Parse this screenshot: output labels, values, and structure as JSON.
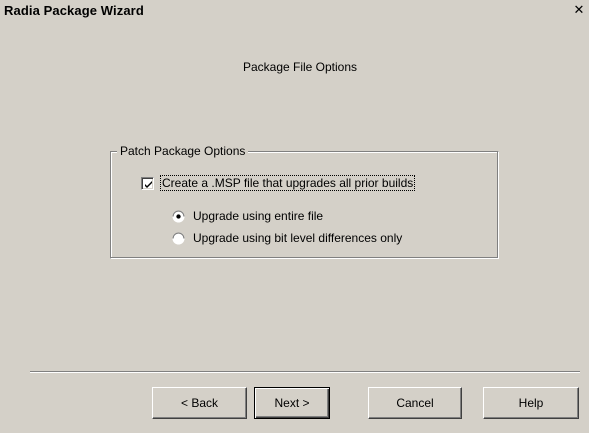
{
  "window": {
    "title": "Radia Package Wizard",
    "close_symbol": "✕"
  },
  "page": {
    "heading": "Package File Options"
  },
  "group": {
    "legend": "Patch Package Options",
    "checkbox": {
      "label": "Create a .MSP file that upgrades all prior builds",
      "checked": true
    },
    "radios": [
      {
        "label": "Upgrade using entire file",
        "selected": true
      },
      {
        "label": "Upgrade using bit level differences only",
        "selected": false
      }
    ]
  },
  "buttons": {
    "back": "< Back",
    "next": "Next >",
    "cancel": "Cancel",
    "help": "Help"
  }
}
